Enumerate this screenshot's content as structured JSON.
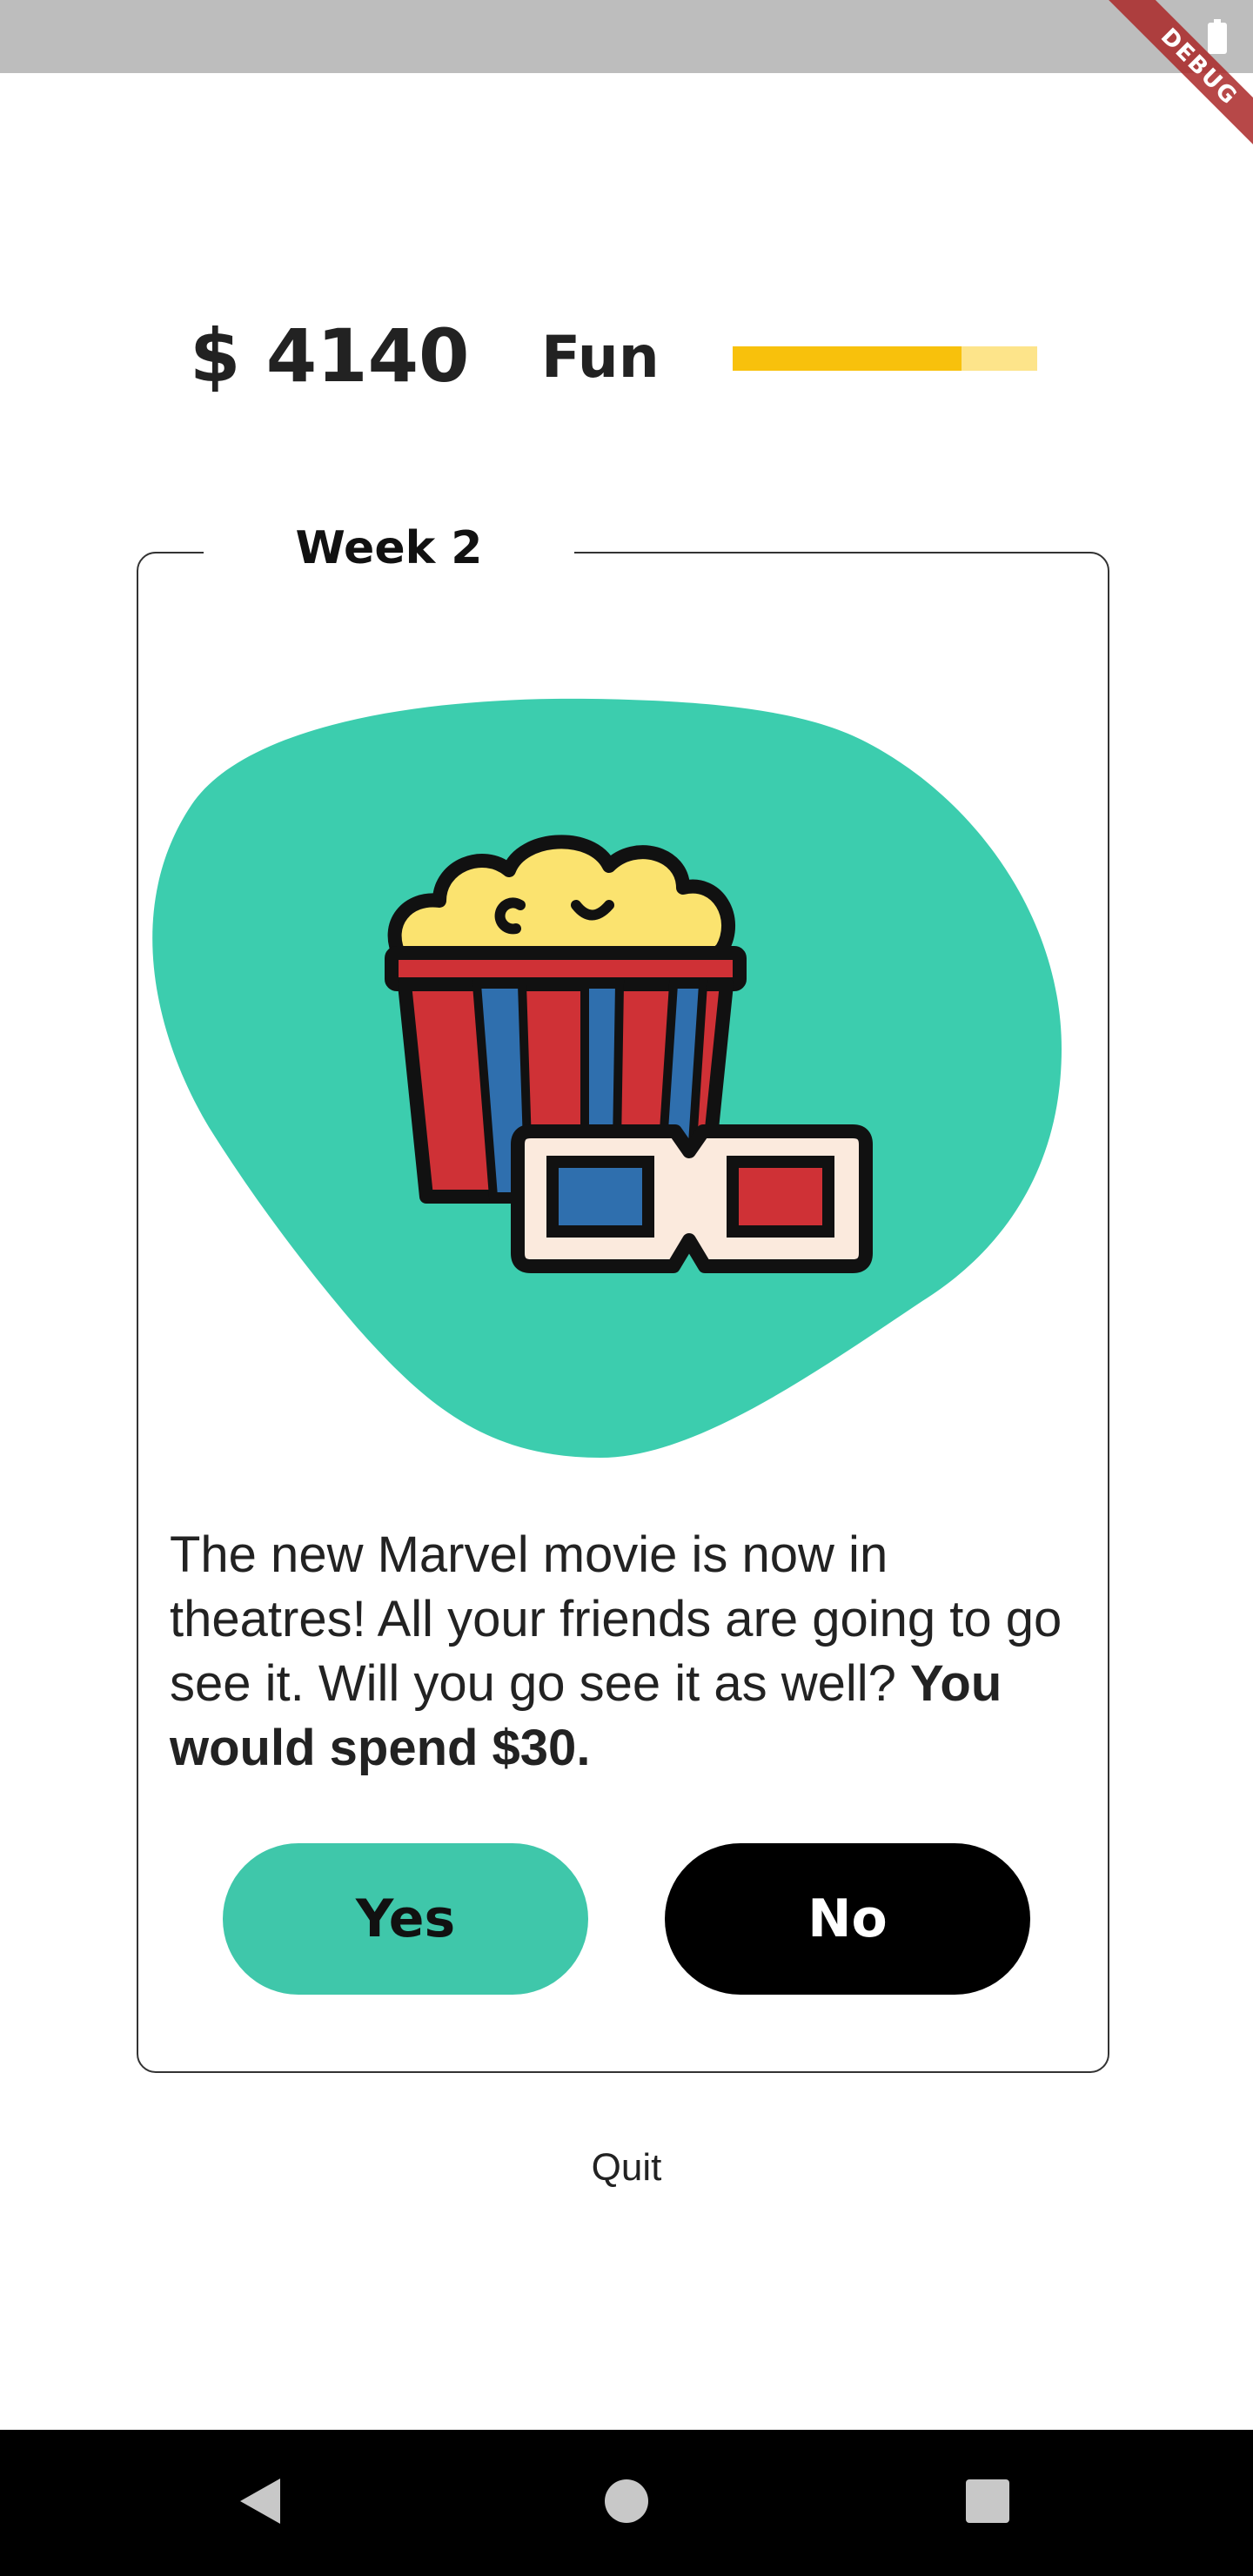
{
  "status_bar": {
    "debug_label": "DEBUG"
  },
  "header": {
    "money": "$ 4140",
    "fun_label": "Fun",
    "fun_level": 0.75
  },
  "card": {
    "week_label": "Week 2",
    "description": "The new Marvel movie is now in theatres! All your friends are going to go see it. Will you go see it as well?",
    "cost_text": "You would spend $30.",
    "yes_label": "Yes",
    "no_label": "No"
  },
  "quit_label": "Quit",
  "colors": {
    "accent": "#3fc7aa",
    "fun_bar": "#f8c10c",
    "fun_bar_track": "#fde48a"
  }
}
